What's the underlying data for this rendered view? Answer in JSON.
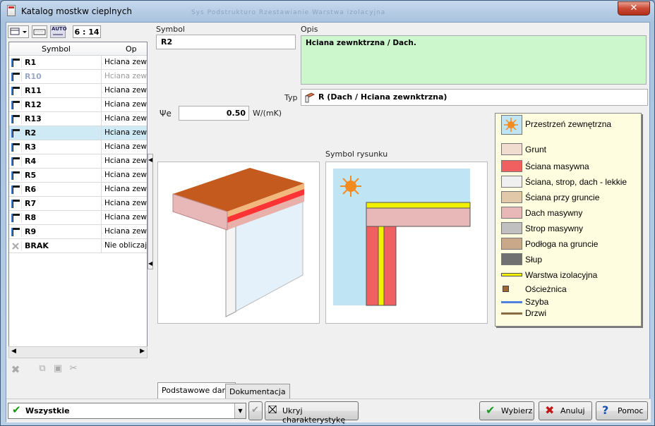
{
  "window": {
    "title": "Katalog mostkw cieplnych",
    "ghost_tabs": "Sys   Podstrukturo   Rzestawianie   Warstwa izolacyjna"
  },
  "toolbar": {
    "counter": "6 : 14",
    "auto": "AUTO"
  },
  "grid": {
    "col_symbol": "Symbol",
    "col_opis": "Op",
    "rows": [
      {
        "symbol": "R1",
        "desc": "Hciana zewn",
        "dim": false
      },
      {
        "symbol": "R10",
        "desc": "Hciana zew",
        "dim": true
      },
      {
        "symbol": "R11",
        "desc": "Hciana zew",
        "dim": false
      },
      {
        "symbol": "R12",
        "desc": "Hciana zew",
        "dim": false
      },
      {
        "symbol": "R13",
        "desc": "Hciana zew",
        "dim": false
      },
      {
        "symbol": "R2",
        "desc": "Hciana zew",
        "dim": false,
        "selected": true
      },
      {
        "symbol": "R3",
        "desc": "Hciana zew",
        "dim": false
      },
      {
        "symbol": "R4",
        "desc": "Hciana zew",
        "dim": false
      },
      {
        "symbol": "R5",
        "desc": "Hciana zew",
        "dim": false
      },
      {
        "symbol": "R6",
        "desc": "Hciana zew",
        "dim": false
      },
      {
        "symbol": "R7",
        "desc": "Hciana zew",
        "dim": false
      },
      {
        "symbol": "R8",
        "desc": "Hciana zew",
        "dim": false
      },
      {
        "symbol": "R9",
        "desc": "Hciana zew",
        "dim": false
      },
      {
        "symbol": "BRAK",
        "desc": "Nie obliczaj",
        "dim": false,
        "none": true
      }
    ]
  },
  "form": {
    "symbol_label": "Symbol",
    "symbol_value": "R2",
    "opis_label": "Opis",
    "opis_value": "Hciana zewnktrzna / Dach.",
    "typ_label": "Typ",
    "typ_value": "R (Dach / Hciana zewnktrzna)",
    "psi_label": "Ψe",
    "psi_value": "0.50",
    "psi_unit": "W/(mK)",
    "symbol_rysunku_label": "Symbol rysunku"
  },
  "legend": [
    {
      "label": "Przestrzeń zewnętrzna",
      "color": "#bfe5f5",
      "kind": "sun"
    },
    {
      "label": "Grunt",
      "color": "#f0ddd0",
      "kind": "box"
    },
    {
      "label": "Ściana masywna",
      "color": "#f06060",
      "kind": "box"
    },
    {
      "label": "Ściana, strop, dach - lekkie",
      "color": "#f0f0f0",
      "kind": "box"
    },
    {
      "label": "Ściana przy gruncie",
      "color": "#e0c8a8",
      "kind": "box"
    },
    {
      "label": "Dach masywny",
      "color": "#e8b8b8",
      "kind": "box"
    },
    {
      "label": "Strop masywny",
      "color": "#c0c0c0",
      "kind": "box"
    },
    {
      "label": "Podłoga na gruncie",
      "color": "#c8a888",
      "kind": "box"
    },
    {
      "label": "Słup",
      "color": "#707070",
      "kind": "box"
    },
    {
      "label": "Warstwa izolacyjna",
      "color": "#f0f000",
      "kind": "line"
    },
    {
      "label": "Ościeżnica",
      "color": "#a06830",
      "kind": "small"
    },
    {
      "label": "Szyba",
      "color": "#5080e0",
      "kind": "thin"
    },
    {
      "label": "Drzwi",
      "color": "#8a6a40",
      "kind": "thin"
    }
  ],
  "tabs": [
    "Podstawowe dane",
    "Dokumentacja"
  ],
  "bottom": {
    "filter": "Wszystkie",
    "hide_btn": "Ukryj charakterystykę",
    "wybierz": "Wybierz",
    "anuluj": "Anuluj",
    "pomoc": "Pomoc"
  }
}
